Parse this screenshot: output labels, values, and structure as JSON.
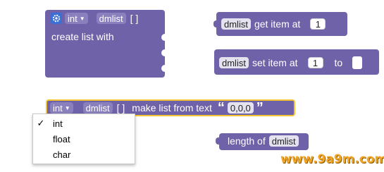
{
  "create_block": {
    "type_value": "int",
    "var_name": "dmlist",
    "brackets": "[ ]",
    "label": "create list with",
    "icon": "gear-icon"
  },
  "get_block": {
    "var_name": "dmlist",
    "label": "get item at",
    "index": "1"
  },
  "set_block": {
    "var_name": "dmlist",
    "label": "set item at",
    "index": "1",
    "to_label": "to"
  },
  "text_block": {
    "type_value": "int",
    "var_name": "dmlist",
    "brackets": "[ ]",
    "label": "make list from text",
    "open_quote": "“",
    "text_value": "0,0,0",
    "close_quote": "”"
  },
  "length_block": {
    "label": "length of",
    "var_name": "dmlist"
  },
  "dropdown": {
    "options": [
      {
        "label": "int",
        "checked": true
      },
      {
        "label": "float",
        "checked": false
      },
      {
        "label": "char",
        "checked": false
      }
    ],
    "check_mark": "✓"
  },
  "watermark": "www.9a9m.com",
  "colors": {
    "block": "#6f62a8",
    "highlight": "#f4c430",
    "gear": "#3b6fd8"
  }
}
